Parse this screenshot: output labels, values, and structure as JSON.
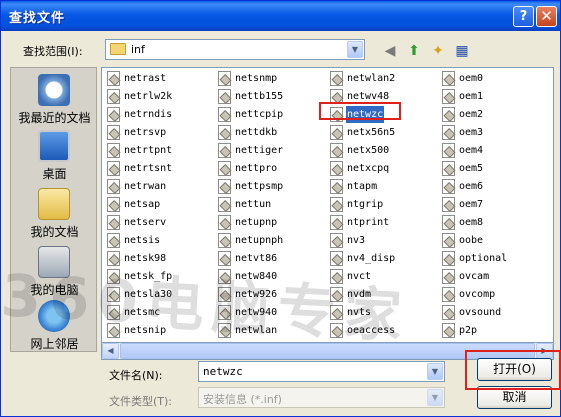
{
  "window": {
    "title": "查找文件",
    "help_label": "?",
    "close_label": "✕"
  },
  "lookin": {
    "label": "查找范围(I):",
    "value": "inf"
  },
  "places": [
    {
      "label": "我最近的文档",
      "icon": "recent-documents-icon"
    },
    {
      "label": "桌面",
      "icon": "desktop-icon"
    },
    {
      "label": "我的文档",
      "icon": "my-documents-icon"
    },
    {
      "label": "我的电脑",
      "icon": "my-computer-icon"
    },
    {
      "label": "网上邻居",
      "icon": "network-places-icon"
    }
  ],
  "files": {
    "col1": [
      "netrast",
      "netrlw2k",
      "netrndis",
      "netrsvp",
      "netrtpnt",
      "netrtsnt",
      "netrwan",
      "netsap",
      "netserv",
      "netsis",
      "netsk98",
      "netsk_fp",
      "netsla30",
      "netsmc",
      "netsnip"
    ],
    "col2": [
      "netsnmp",
      "nettb155",
      "nettcpip",
      "nettdkb",
      "nettiger",
      "nettpro",
      "nettpsmp",
      "nettun",
      "netupnp",
      "netupnph",
      "netvt86",
      "netw840",
      "netw926",
      "netw940",
      "netwlan"
    ],
    "col3": [
      "netwlan2",
      "netwv48",
      "netwzc",
      "netx56n5",
      "netx500",
      "netxcpq",
      "ntapm",
      "ntgrip",
      "ntprint",
      "nv3",
      "nv4_disp",
      "nvct",
      "nvdm",
      "nvts",
      "oeaccess"
    ],
    "col4": [
      "oem0",
      "oem1",
      "oem2",
      "oem3",
      "oem4",
      "oem5",
      "oem6",
      "oem7",
      "oem8",
      "oobe",
      "optional",
      "ovcam",
      "ovcomp",
      "ovsound",
      "p2p"
    ],
    "selected": "netwzc"
  },
  "filename": {
    "label": "文件名(N):",
    "value": "netwzc"
  },
  "filetype": {
    "label": "文件类型(T):",
    "value": "安装信息 (*.inf)"
  },
  "buttons": {
    "open": "打开(O)",
    "cancel": "取消"
  },
  "watermark": "360电脑专家"
}
